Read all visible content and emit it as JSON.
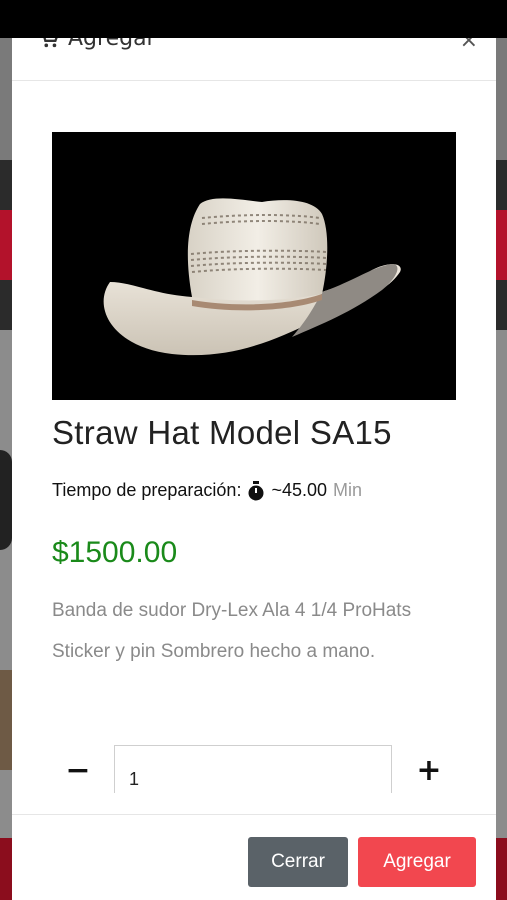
{
  "modal": {
    "title": "Agregar",
    "close_symbol": "×",
    "product": {
      "name": "Straw Hat Model SA15",
      "prep_label": "Tiempo de preparación:",
      "prep_value": "~45.00",
      "prep_unit": "Min",
      "price": "$1500.00",
      "description": "Banda de sudor Dry-Lex Ala 4 1/4 ProHats Sticker y pin Sombrero hecho a mano."
    },
    "quantity": {
      "minus": "−",
      "plus": "+",
      "value": "1"
    },
    "footer": {
      "close_label": "Cerrar",
      "add_label": "Agregar"
    }
  },
  "colors": {
    "price": "#1a8a1a",
    "add_button": "#f2474f",
    "close_button": "#5a6268"
  },
  "icons": [
    "cart-icon",
    "close-icon",
    "stopwatch-icon",
    "minus-icon",
    "plus-icon"
  ]
}
